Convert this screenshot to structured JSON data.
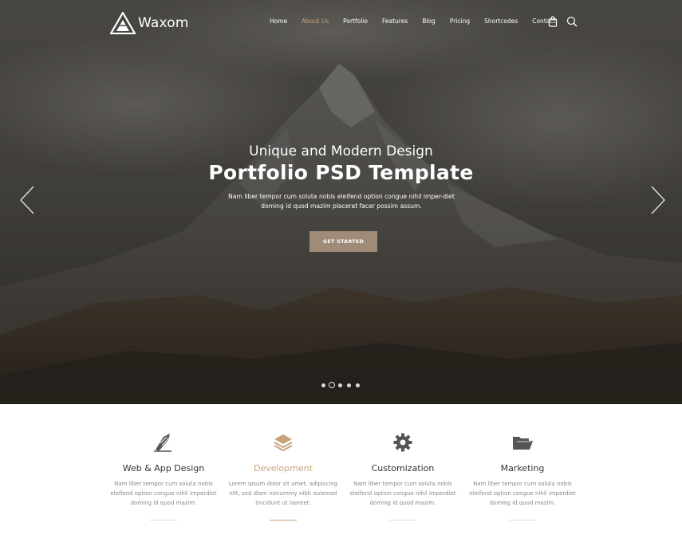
{
  "header": {
    "logo_text": "Waxom",
    "nav": [
      "Home",
      "About Us",
      "Portfolio",
      "Features",
      "Blog",
      "Pricing",
      "Shortcodes",
      "Contact"
    ],
    "active_nav": "About Us",
    "icons": [
      "cart-icon",
      "search-icon"
    ]
  },
  "slider": {
    "subtitle": "Unique and Modern Design",
    "title": "Portfolio PSD Template",
    "description": "Nam liber tempor cum soluta nobis eleifend option congue nihil imper-diet doming id quod mazim placerat facer possim assum.",
    "button_label": "GET STARTED",
    "slide_count": 5,
    "active_slide": 2
  },
  "services": [
    {
      "icon": "pen-icon",
      "title": "Web & App Design",
      "text": "Nam liber tempor cum soluta nobis eleifend option congue nihil imperdiet doming id quod mazim."
    },
    {
      "icon": "layers-icon",
      "title": "Development",
      "text": "Lorem ipsum dolor sit amet, adipiscing elit, sed diam nonummy nibh euismod tincidunt ut laoreet."
    },
    {
      "icon": "gear-icon",
      "title": "Customization",
      "text": "Nam liber tempor cum soluta nobis eleifend option congue nihil imperdiet doming id quod mazim."
    },
    {
      "icon": "folder-icon",
      "title": "Marketing",
      "text": "Nam liber tempor cum soluta nobis eleifend option congue nihil imperdiet doming id quod mazim."
    }
  ],
  "colors": {
    "accent": "#c8a27d",
    "button": "#a08a78",
    "text_dark": "#333333",
    "text_muted": "#888888"
  }
}
